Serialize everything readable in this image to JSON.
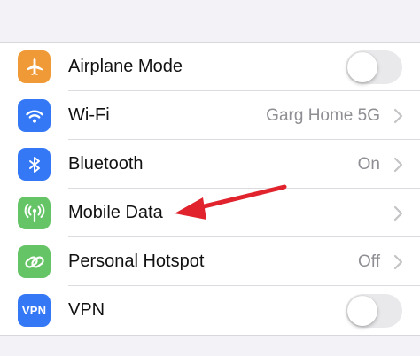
{
  "colors": {
    "airplane": "#f09a37",
    "wifi": "#3478f6",
    "bluetooth": "#3478f6",
    "mobile_data": "#65c466",
    "hotspot": "#65c466",
    "vpn": "#3478f6",
    "annotation_arrow": "#e0232d"
  },
  "settings": {
    "rows": [
      {
        "label": "Airplane Mode",
        "icon": "airplane-icon",
        "control": "toggle",
        "toggle_on": false
      },
      {
        "label": "Wi-Fi",
        "icon": "wifi-icon",
        "value": "Garg Home 5G",
        "control": "chevron"
      },
      {
        "label": "Bluetooth",
        "icon": "bluetooth-icon",
        "value": "On",
        "control": "chevron"
      },
      {
        "label": "Mobile Data",
        "icon": "antenna-icon",
        "control": "chevron"
      },
      {
        "label": "Personal Hotspot",
        "icon": "link-icon",
        "value": "Off",
        "control": "chevron"
      },
      {
        "label": "VPN",
        "icon": "vpn-icon",
        "icon_text": "VPN",
        "control": "toggle",
        "toggle_on": false
      }
    ]
  }
}
